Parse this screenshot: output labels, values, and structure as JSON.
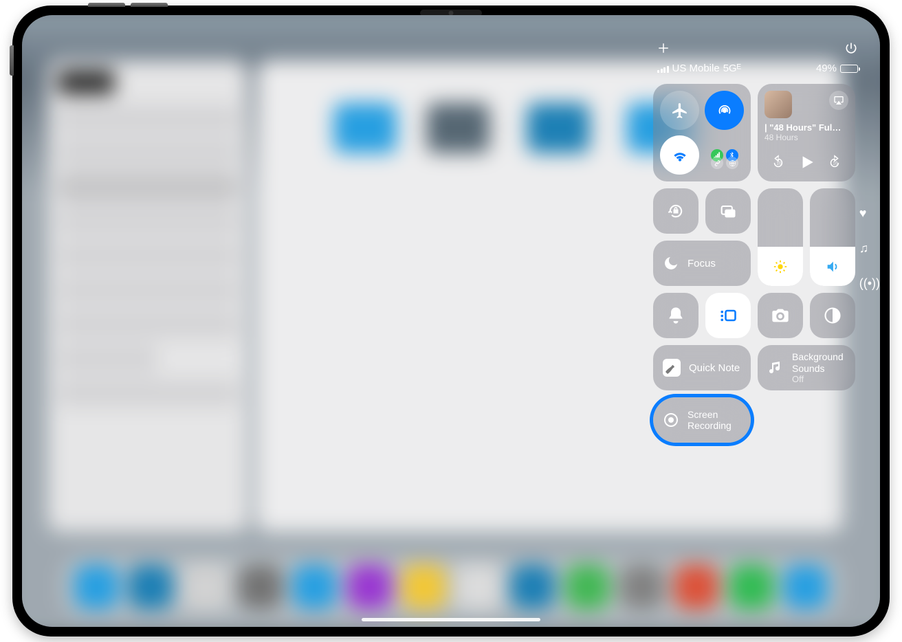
{
  "status": {
    "carrier": "US Mobile",
    "network": "5Gᴱ",
    "battery_pct": "49%"
  },
  "media": {
    "title": "| \"48 Hours\" Ful…",
    "subtitle": "48 Hours"
  },
  "focus": {
    "label": "Focus"
  },
  "quicknote": {
    "label": "Quick Note"
  },
  "bgsounds": {
    "label": "Background\nSounds",
    "state": "Off"
  },
  "screenrec": {
    "label": "Screen\nRecording"
  },
  "sliders": {
    "brightness_pct": 40,
    "volume_pct": 40
  },
  "dock_colors": [
    "#2aa8ee",
    "#1f87bf",
    "#dedede",
    "#7a7a7a",
    "#2aa8ee",
    "#a23bdd",
    "#ffd23a",
    "#e8e8e8",
    "#1f87bf",
    "#47c25a",
    "#8a8a8a",
    "#e8573d",
    "#36c759",
    "#2aa8ee"
  ]
}
